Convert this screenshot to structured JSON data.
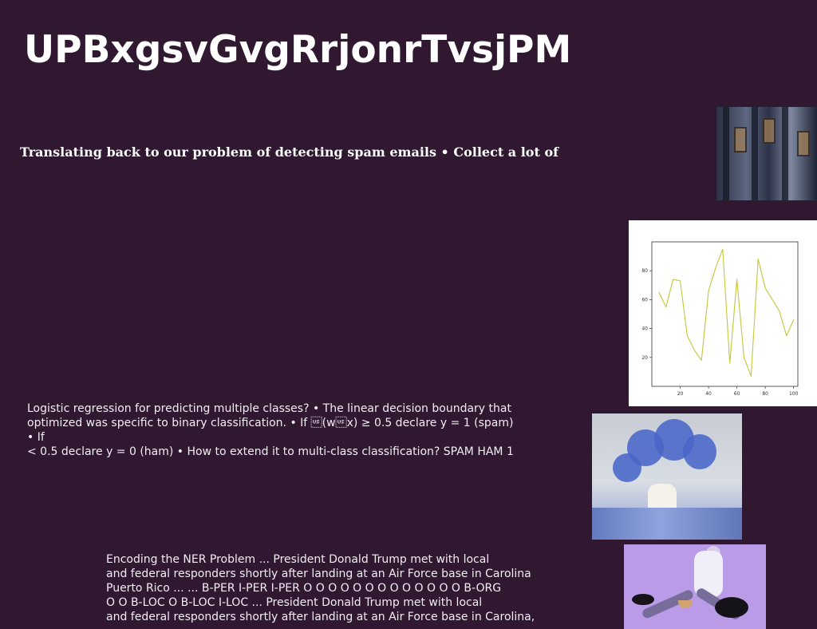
{
  "slide": {
    "title": "UPBxgsvGvgRrjonrTvsjPM",
    "subtitle": "Translating back to our problem of detecting spam emails • Collect a lot of",
    "text_blocks": [
      {
        "text": "Logistic regression for predicting multiple classes? • The linear decision boundary that\noptimized was specific to binary classification. • If \u001f(w\u001fx) ≥ 0.5 declare y = 1 (spam) • If\n< 0.5 declare y = 0 (ham) • How to extend it to multi-class classification? SPAM HAM 1"
      },
      {
        "text": "Encoding the NER Problem ... President Donald Trump met with local\nand federal responders shortly after landing at an Air Force base in Carolina\nPuerto Rico ... ... B-PER I-PER I-PER O O O O O O O O O O O O O B-ORG\nO O B-LOC O B-LOC I-LOC ... President Donald Trump met with local\nand federal responders shortly after landing at an Air Force base in Carolina,"
      }
    ]
  },
  "images": {
    "building": "building-photo",
    "flowers": "blue-flowers-photo",
    "person": "person-on-purple-photo"
  },
  "chart_data": {
    "type": "line",
    "x": [
      5,
      10,
      15,
      20,
      25,
      30,
      35,
      40,
      45,
      50,
      55,
      60,
      65,
      70,
      75,
      80,
      85,
      90,
      95,
      100
    ],
    "series": [
      {
        "values": [
          65,
          55,
          74,
          73,
          35,
          25,
          18,
          66,
          82,
          95,
          16,
          74,
          20,
          7,
          88,
          68,
          60,
          52,
          35,
          46
        ],
        "color": "#c5c940"
      }
    ],
    "x_ticks": [
      20,
      40,
      60,
      80,
      100
    ],
    "y_ticks": [
      20,
      40,
      60,
      80
    ],
    "xlim": [
      0,
      103
    ],
    "ylim": [
      0,
      100
    ],
    "grid": false,
    "title": "",
    "xlabel": "",
    "ylabel": ""
  }
}
